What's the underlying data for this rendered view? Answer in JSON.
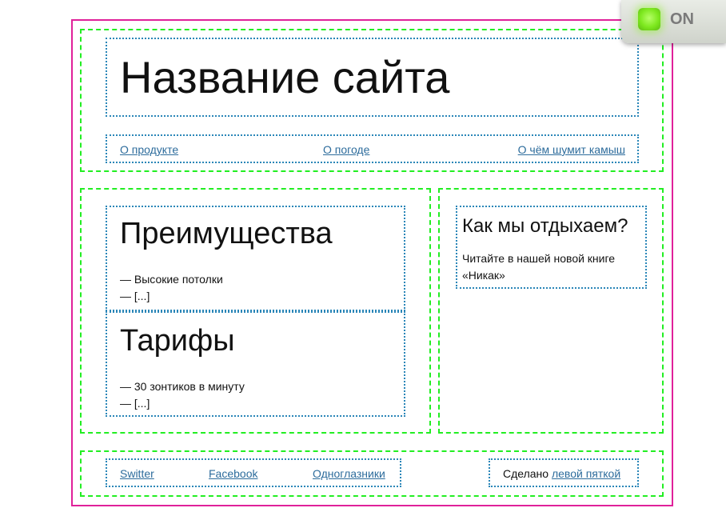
{
  "header": {
    "site_title": "Название сайта",
    "nav": [
      "О продукте",
      "О погоде",
      "О чём шумит камыш"
    ]
  },
  "main": {
    "sections": [
      {
        "heading": "Преимущества",
        "lines": [
          "— Высокие потолки",
          "— [...]"
        ]
      },
      {
        "heading": "Тарифы",
        "lines": [
          "— 30 зонтиков в минуту",
          "— [...]"
        ]
      }
    ]
  },
  "aside": {
    "heading": "Как мы отдыхаем?",
    "text": "Читайте в нашей новой книге «Никак»"
  },
  "footer": {
    "social_links": [
      "Switter",
      "Facebook",
      "Одноглазники"
    ],
    "credit_prefix": "Сделано ",
    "credit_link": "левой пяткой"
  },
  "toggle": {
    "label": "ON",
    "state": "on",
    "indicator_color": "#7de81e"
  },
  "colors": {
    "page_border": "#e0219a",
    "block_border": "#22ee22",
    "inner_border": "#2a86b8",
    "link": "#2d6c9c"
  }
}
